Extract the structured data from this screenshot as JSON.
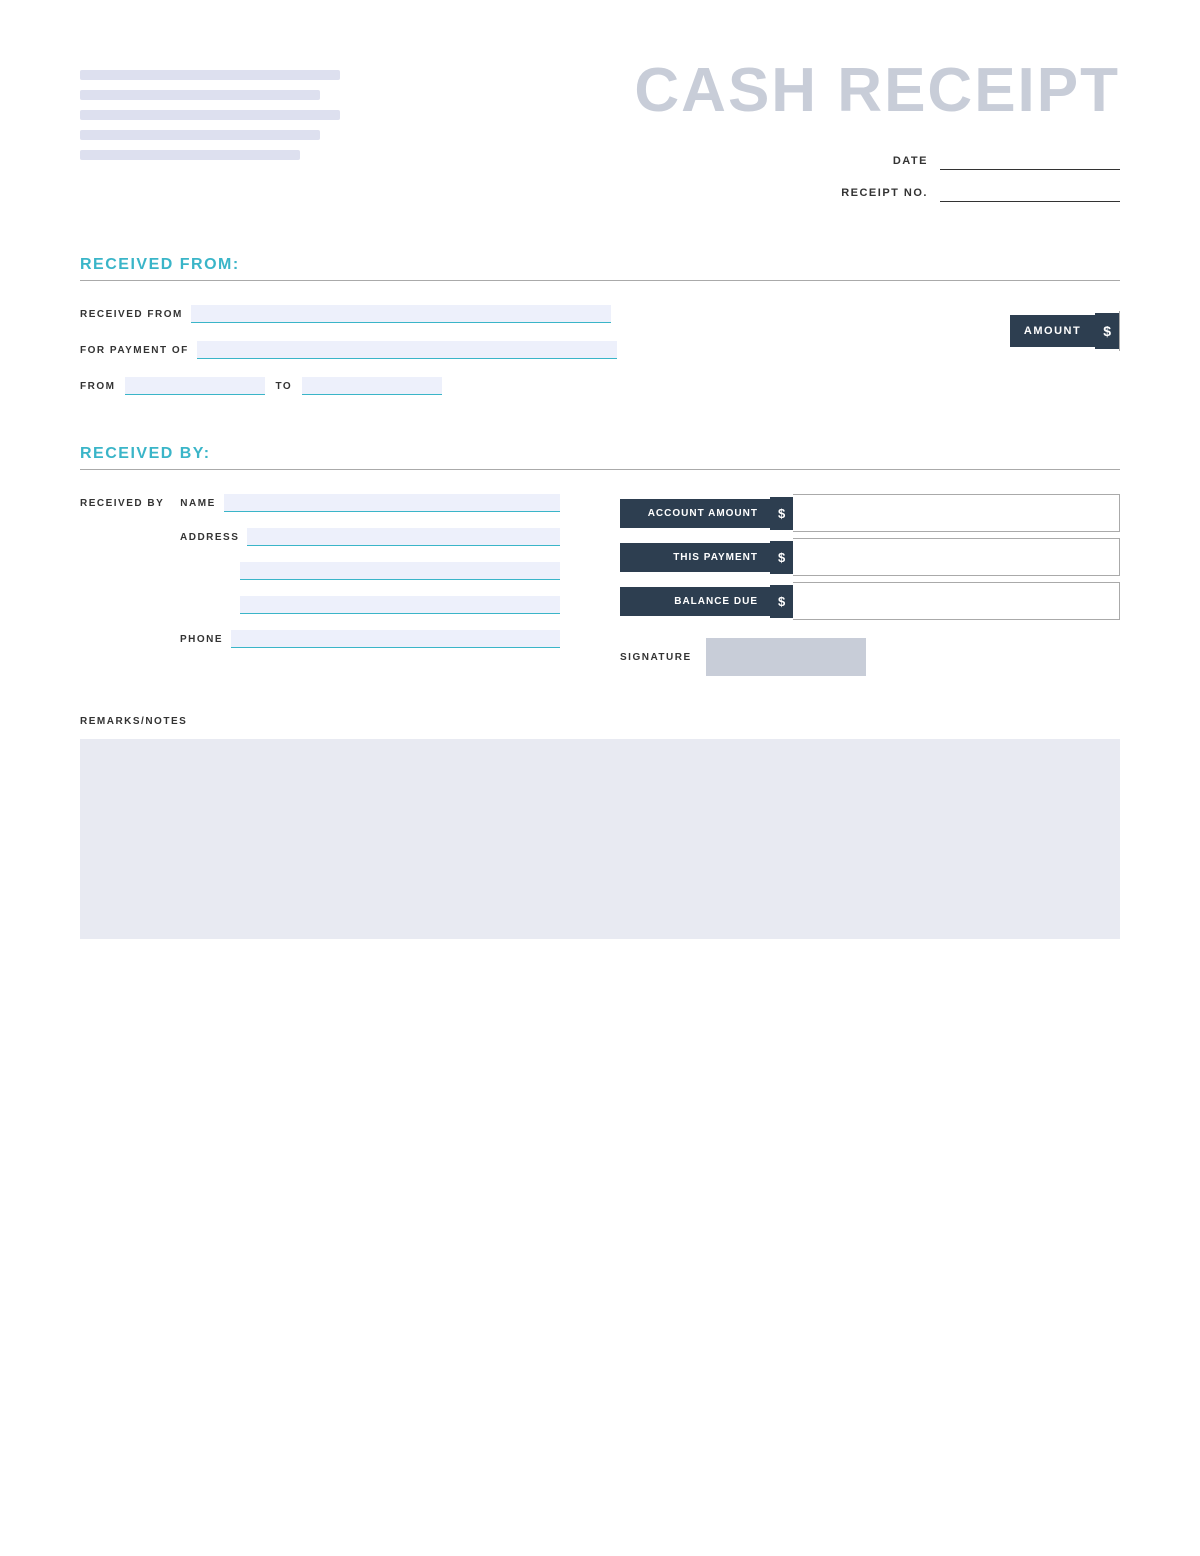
{
  "header": {
    "title": "CASH RECEIPT",
    "date_label": "DATE",
    "receipt_no_label": "RECEIPT NO."
  },
  "received_from_section": {
    "title": "RECEIVED FROM:",
    "received_from_label": "RECEIVED FROM",
    "for_payment_label": "FOR PAYMENT OF",
    "from_label": "FROM",
    "to_label": "TO",
    "amount_label": "AMOUNT",
    "dollar_sign": "$"
  },
  "received_by_section": {
    "title": "RECEIVED BY:",
    "received_by_label": "RECEIVED BY",
    "name_label": "NAME",
    "address_label": "ADDRESS",
    "phone_label": "PHONE",
    "account_amount_label": "ACCOUNT AMOUNT",
    "this_payment_label": "THIS PAYMENT",
    "balance_due_label": "BALANCE DUE",
    "dollar_sign": "$",
    "signature_label": "SIGNATURE"
  },
  "remarks_section": {
    "label": "REMARKS/NOTES"
  }
}
